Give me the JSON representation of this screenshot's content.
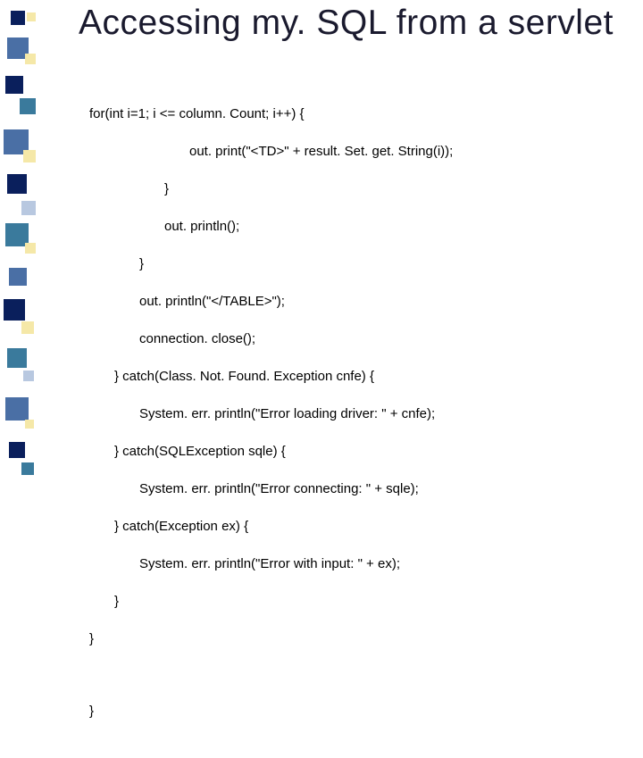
{
  "title": "Accessing my. SQL from a servlet",
  "code": {
    "l0": "for(int i=1; i <= column. Count; i++) {",
    "l1": "out. print(\"<TD>\" + result. Set. get. String(i));",
    "l2": "}",
    "l3": "out. println();",
    "l4": "}",
    "l5": "out. println(\"</TABLE>\");",
    "l6": "connection. close();",
    "l7": "} catch(Class. Not. Found. Exception cnfe) {",
    "l8": "System. err. println(\"Error loading driver: \" + cnfe);",
    "l9": "} catch(SQLException sqle) {",
    "l10": "System. err. println(\"Error connecting: \" + sqle);",
    "l11": "} catch(Exception ex) {",
    "l12": "System. err. println(\"Error with input: \" + ex);",
    "l13": "}",
    "l14": "}",
    "l15": "}"
  },
  "colors": {
    "navy": "#0a1f5c",
    "cream": "#f5e8a8",
    "teal": "#3a7a9c",
    "blue": "#4a6fa5",
    "light": "#b8c8e0"
  }
}
